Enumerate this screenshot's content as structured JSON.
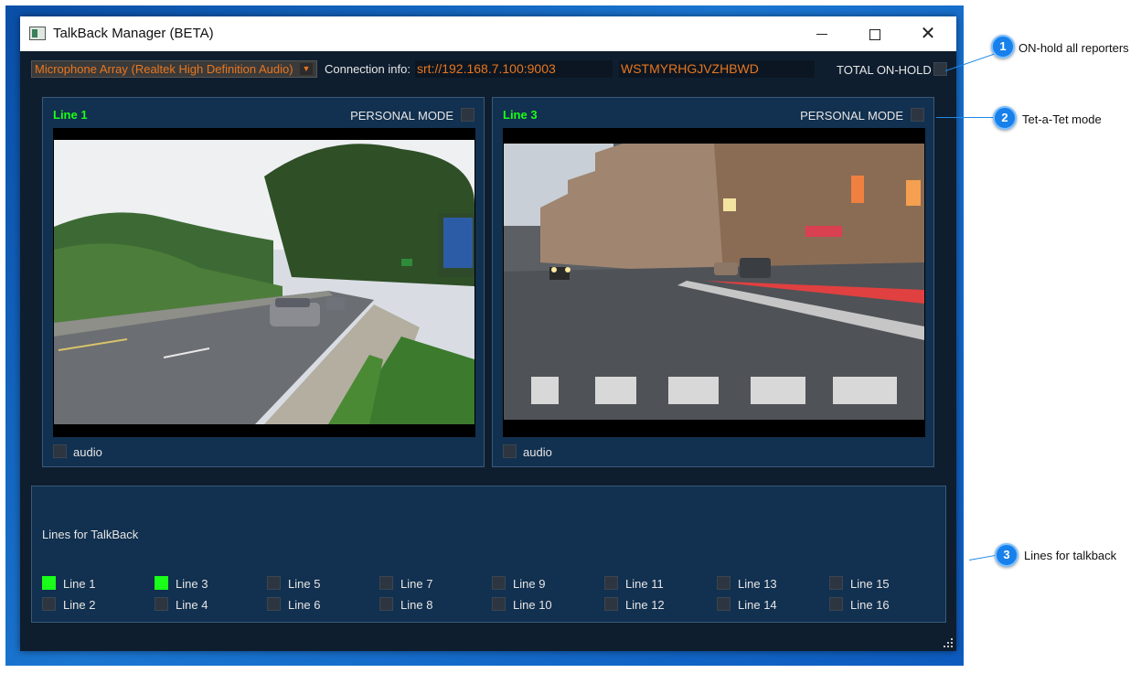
{
  "window": {
    "title": "TalkBack Manager (BETA)",
    "min_icon": "minimize-icon",
    "max_icon": "maximize-icon",
    "close_icon": "close-icon",
    "close_glyph": "✕"
  },
  "toolbar": {
    "microphone": "Microphone Array (Realtek High Definition Audio)",
    "dropdown_glyph": "▼",
    "connection_label": "Connection info:",
    "connection_url": "srt://192.168.7.100:9003",
    "connection_key": "WSTMYRHGJVZHBWD",
    "total_onhold_label": "TOTAL ON-HOLD"
  },
  "lines_panels": [
    {
      "name": "Line 1",
      "personal_mode_label": "PERSONAL MODE",
      "audio_label": "audio",
      "video": "suburban-road-scene"
    },
    {
      "name": "Line 3",
      "personal_mode_label": "PERSONAL MODE",
      "audio_label": "audio",
      "video": "city-street-evening-scene"
    }
  ],
  "talkback": {
    "title": "Lines for TalkBack",
    "lines": [
      {
        "label": "Line 1",
        "checked": true
      },
      {
        "label": "Line 2",
        "checked": false
      },
      {
        "label": "Line 3",
        "checked": true
      },
      {
        "label": "Line 4",
        "checked": false
      },
      {
        "label": "Line 5",
        "checked": false
      },
      {
        "label": "Line 6",
        "checked": false
      },
      {
        "label": "Line 7",
        "checked": false
      },
      {
        "label": "Line 8",
        "checked": false
      },
      {
        "label": "Line 9",
        "checked": false
      },
      {
        "label": "Line 10",
        "checked": false
      },
      {
        "label": "Line 11",
        "checked": false
      },
      {
        "label": "Line 12",
        "checked": false
      },
      {
        "label": "Line 13",
        "checked": false
      },
      {
        "label": "Line 14",
        "checked": false
      },
      {
        "label": "Line 15",
        "checked": false
      },
      {
        "label": "Line 16",
        "checked": false
      }
    ]
  },
  "callouts": [
    {
      "number": "1",
      "text": "ON-hold all reporters"
    },
    {
      "number": "2",
      "text": "Tet-a-Tet mode"
    },
    {
      "number": "3",
      "text": "Lines for talkback"
    }
  ],
  "colors": {
    "active_green": "#19ff19",
    "accent_orange": "#e8761f",
    "panel_bg": "#12304f",
    "callout_blue": "#1780ea"
  }
}
